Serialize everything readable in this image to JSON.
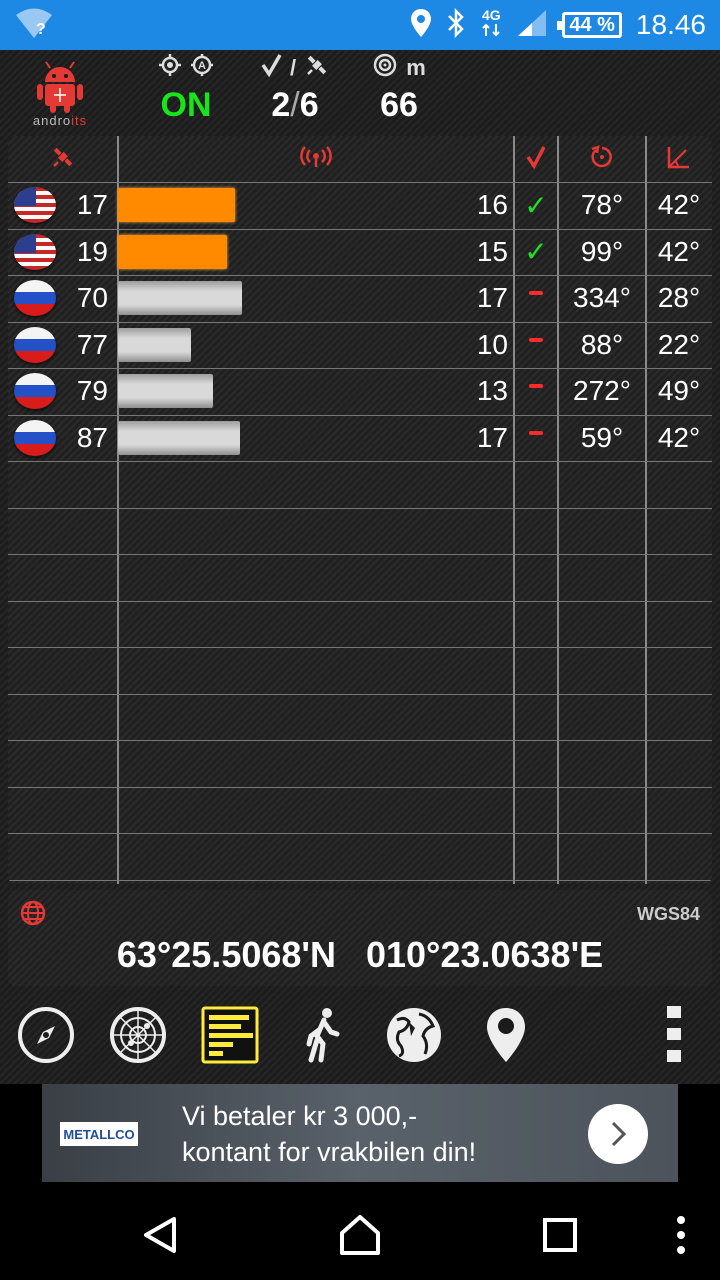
{
  "status_bar": {
    "network": "4G",
    "battery": "44 %",
    "time": "18.46"
  },
  "header": {
    "logo_text_prefix": "andro",
    "logo_text_suffix": "its",
    "fix_state": "ON",
    "sats_sep": "/",
    "sats_used": "2",
    "sats_visible": "6",
    "accuracy_unit": "m",
    "accuracy_value": "66"
  },
  "satellites": [
    {
      "flag": "us",
      "prn": "17",
      "snr": "16",
      "snr_fraction": 0.94,
      "used": true,
      "azimuth": "78°",
      "elevation": "42°"
    },
    {
      "flag": "us",
      "prn": "19",
      "snr": "15",
      "snr_fraction": 0.88,
      "used": true,
      "azimuth": "99°",
      "elevation": "42°"
    },
    {
      "flag": "ru",
      "prn": "70",
      "snr": "17",
      "snr_fraction": 1.0,
      "used": false,
      "azimuth": "334°",
      "elevation": "28°"
    },
    {
      "flag": "ru",
      "prn": "77",
      "snr": "10",
      "snr_fraction": 0.59,
      "used": false,
      "azimuth": "88°",
      "elevation": "22°"
    },
    {
      "flag": "ru",
      "prn": "79",
      "snr": "13",
      "snr_fraction": 0.77,
      "used": false,
      "azimuth": "272°",
      "elevation": "49°"
    },
    {
      "flag": "ru",
      "prn": "87",
      "snr": "17",
      "snr_fraction": 0.98,
      "used": false,
      "azimuth": "59°",
      "elevation": "42°"
    }
  ],
  "empty_rows": 9,
  "check_symbol": "✓",
  "position": {
    "datum": "WGS84",
    "latitude": "63°25.5068'N",
    "longitude": "010°23.0638'E"
  },
  "toolbar": [
    "compass-icon",
    "radar-icon",
    "signal-bars-icon",
    "walking-icon",
    "globe-icon",
    "map-pin-icon",
    "overflow-menu-icon"
  ],
  "ad": {
    "brand": "METALLCO",
    "line1": "Vi betaler kr 3 000,-",
    "line2": "kontant for vrakbilen din!"
  },
  "colors": {
    "status_bar": "#1e88e5",
    "fix_on": "#19e619",
    "bar_used": "#ff8a00",
    "bar_unused": "#d9d9d9",
    "header_icon_red": "#e53935"
  }
}
